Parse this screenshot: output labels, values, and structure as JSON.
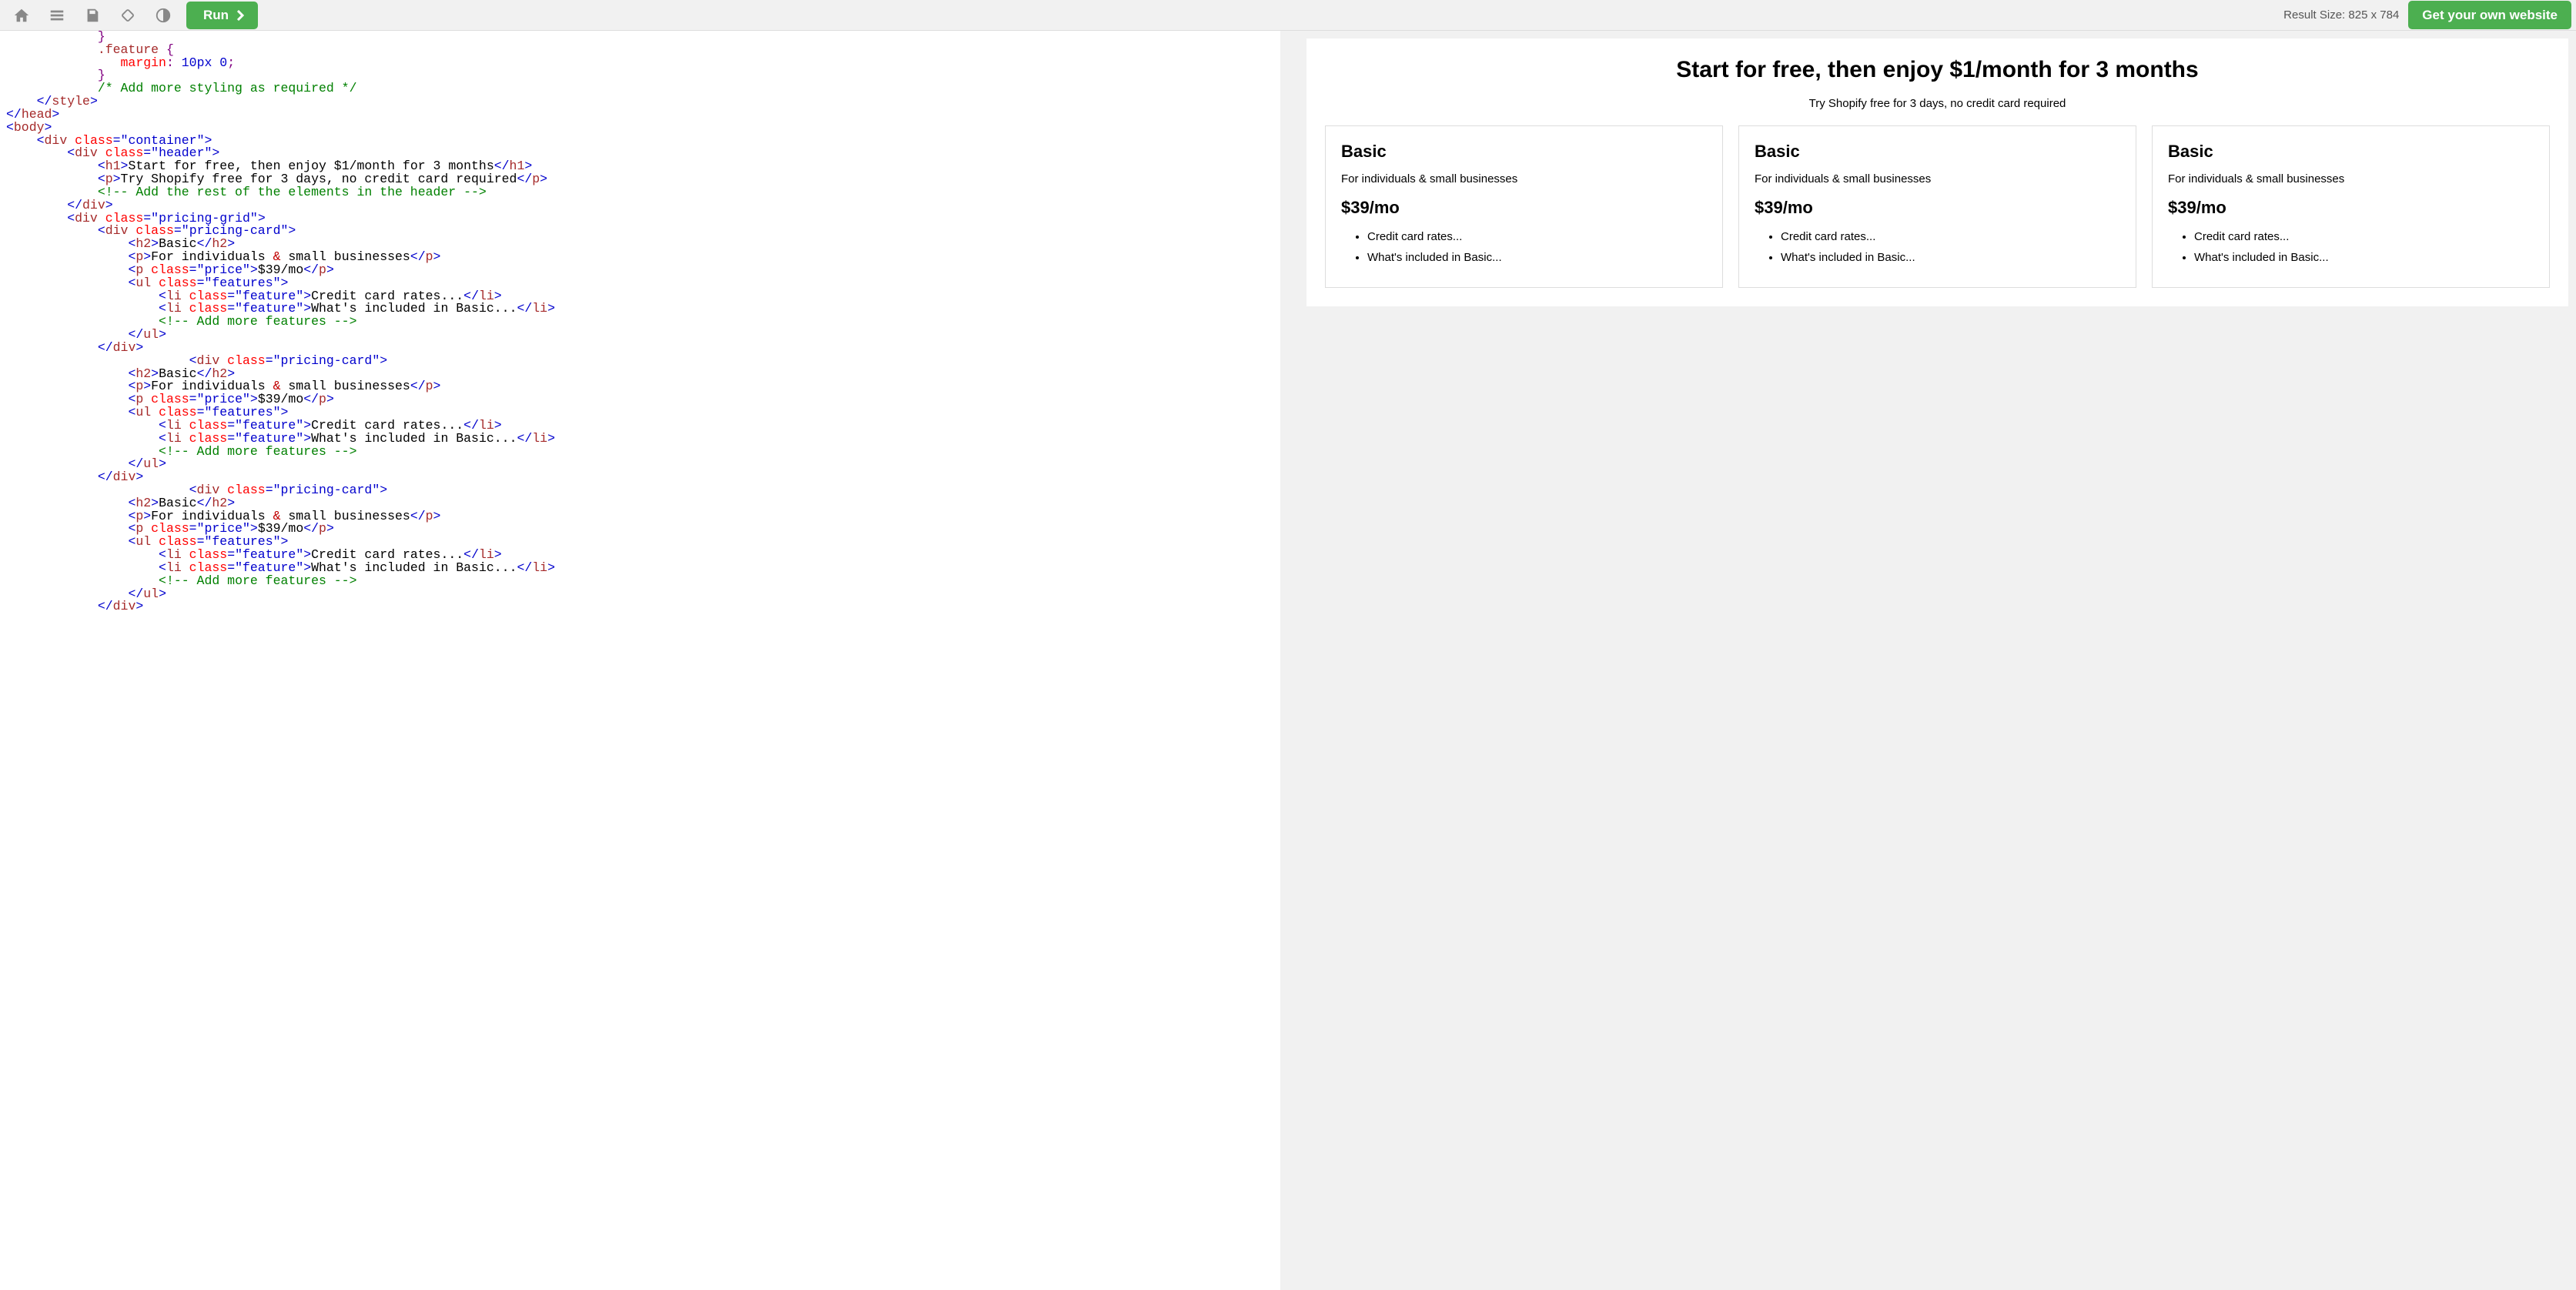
{
  "toolbar": {
    "run_label": "Run",
    "result_size_prefix": "Result Size:",
    "result_width": "825",
    "result_height": "784",
    "cta_label": "Get your own website"
  },
  "code": {
    "l01_i": "            }",
    "l02_i": "            ",
    "l02_sel": ".feature",
    "l02_brace": " {",
    "l03_i": "               ",
    "l03_prop": "margin",
    "l03_colon": ": ",
    "l03_val": "10px 0",
    "l03_semi": ";",
    "l04_i": "            }",
    "l05_i": "            ",
    "l05_cmt": "/* Add more styling as required */",
    "l06_i": "    ",
    "lt_styleclose_o": "</",
    "lt_styleclose_t": "style",
    "lt_styleclose_c": ">",
    "lt_headclose_o": "</",
    "lt_headclose_t": "head",
    "lt_headclose_c": ">",
    "lt_body_o": "<",
    "lt_body_t": "body",
    "lt_body_c": ">",
    "i4": "    ",
    "lt_div_o": "<",
    "lt_div_t": "div",
    "sp": " ",
    "attr_class": "class",
    "eq": "=",
    "q": "\"",
    "val_container": "container",
    "lt_div_c": ">",
    "i8": "        ",
    "val_header": "header",
    "i12": "            ",
    "lt_h1_o": "<",
    "lt_h1_t": "h1",
    "lt_h1_c": ">",
    "txt_h1": "Start for free, then enjoy $1/month for 3 months",
    "lt_h1_co": "</",
    "lt_p_o": "<",
    "lt_p_t": "p",
    "lt_p_c": ">",
    "txt_sub": "Try Shopify free for 3 days, no credit card required",
    "lt_p_co": "</",
    "cmt_header": "<!-- Add the rest of the elements in the header -->",
    "lt_div_co": "</",
    "val_pricinggrid": "pricing-grid",
    "val_pricingcard": "pricing-card",
    "i16": "                ",
    "lt_h2_o": "<",
    "lt_h2_t": "h2",
    "lt_h2_c": ">",
    "txt_basic": "Basic",
    "lt_h2_co": "</",
    "txt_forind": "For individuals ",
    "txt_amp": "&",
    "txt_smallbiz": " small businesses",
    "val_price": "price",
    "txt_price": "$39/mo",
    "lt_ul_o": "<",
    "lt_ul_t": "ul",
    "lt_ul_c": ">",
    "val_features": "features",
    "i20": "                    ",
    "lt_li_o": "<",
    "lt_li_t": "li",
    "lt_li_c": ">",
    "val_feature": "feature",
    "txt_cc": "Credit card rates...",
    "lt_li_co": "</",
    "txt_inc": "What's included in Basic...",
    "cmt_more": "<!-- Add more features -->",
    "lt_ul_co": "</",
    "i24": "                        "
  },
  "result": {
    "heading": "Start for free, then enjoy $1/month for 3 months",
    "sub": "Try Shopify free for 3 days, no credit card required",
    "cards": [
      {
        "title": "Basic",
        "sub": "For individuals & small businesses",
        "price": "$39/mo",
        "f1": "Credit card rates...",
        "f2": "What's included in Basic..."
      },
      {
        "title": "Basic",
        "sub": "For individuals & small businesses",
        "price": "$39/mo",
        "f1": "Credit card rates...",
        "f2": "What's included in Basic..."
      },
      {
        "title": "Basic",
        "sub": "For individuals & small businesses",
        "price": "$39/mo",
        "f1": "Credit card rates...",
        "f2": "What's included in Basic..."
      }
    ]
  }
}
